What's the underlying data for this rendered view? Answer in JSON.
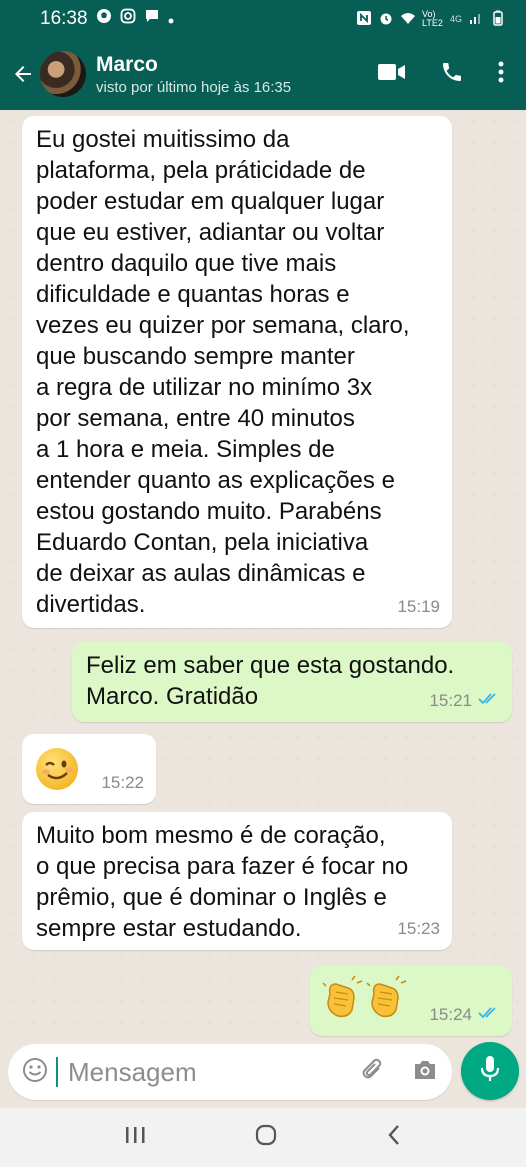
{
  "status_bar": {
    "time": "16:38",
    "network_label": "Vo) LTE2",
    "signal_label": "4G"
  },
  "header": {
    "contact_name": "Marco",
    "last_seen": "visto por último hoje às 16:35"
  },
  "messages": [
    {
      "direction": "incoming",
      "text": "Eu gostei muitissimo da\nplataforma, pela práticidade de\npoder estudar em qualquer lugar\nque eu estiver, adiantar ou voltar\ndentro daquilo que tive mais\ndificuldade e quantas horas e\nvezes eu quizer por semana, claro,\nque buscando sempre manter\na regra de utilizar no minímo 3x\npor semana, entre 40 minutos\na 1 hora e meia. Simples de\nentender quanto as explicações e\nestou gostando muito. Parabéns\nEduardo Contan, pela iniciativa\nde deixar as aulas dinâmicas e\ndivertidas.",
      "time": "15:19"
    },
    {
      "direction": "outgoing",
      "text": "Feliz em saber que esta gostando.\nMarco.  Gratidão",
      "time": "15:21",
      "read": true
    },
    {
      "direction": "incoming",
      "emoji": "winking-smile",
      "time": "15:22"
    },
    {
      "direction": "incoming",
      "text": "Muito bom mesmo é de coração,\no que precisa para fazer é focar no\nprêmio, que é dominar o Inglês e\nsempre estar estudando.",
      "time": "15:23"
    },
    {
      "direction": "outgoing",
      "emoji": "clapping-hands",
      "time": "15:24",
      "read": true
    }
  ],
  "composer": {
    "placeholder": "Mensagem"
  },
  "colors": {
    "header": "#075e54",
    "incoming_bubble": "#ffffff",
    "outgoing_bubble": "#dcf8c6",
    "chat_background": "#ece5dd",
    "read_ticks": "#34b7f1",
    "mic_button": "#00a884"
  }
}
